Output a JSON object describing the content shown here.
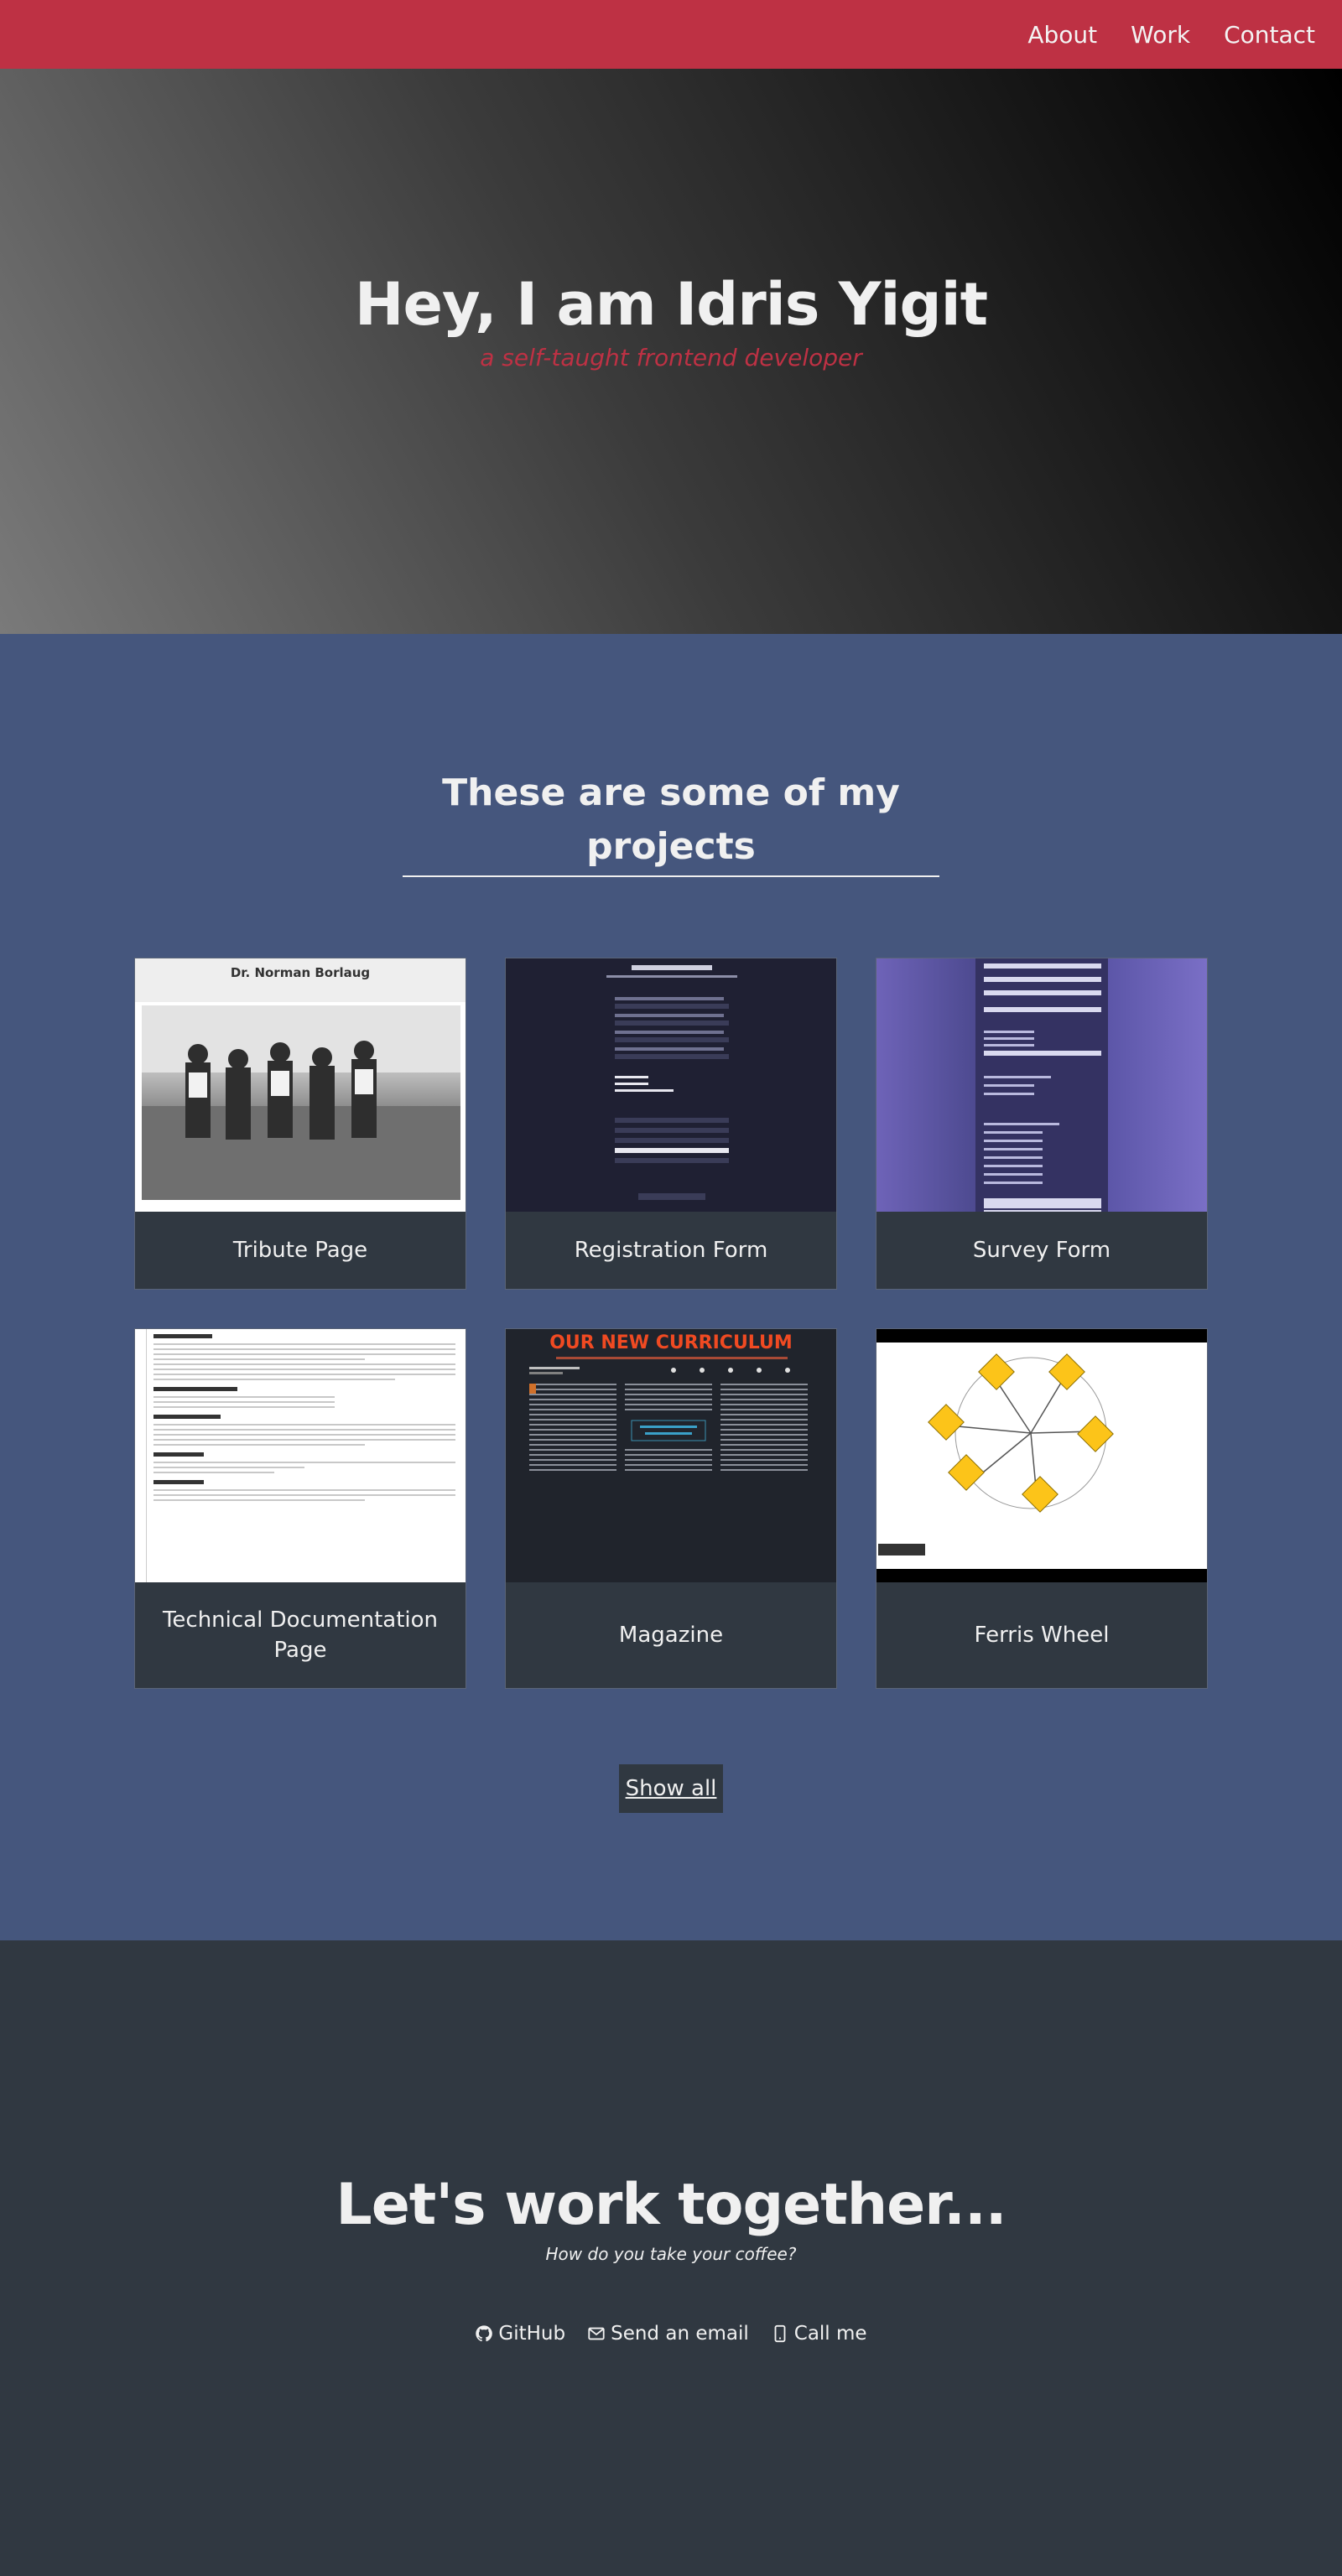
{
  "nav": {
    "links": [
      "About",
      "Work",
      "Contact"
    ]
  },
  "hero": {
    "title": "Hey, I am Idris Yigit",
    "subtitle": "a self-taught frontend developer"
  },
  "projects": {
    "heading": "These are some of my projects",
    "items": [
      {
        "caption": "Tribute Page"
      },
      {
        "caption": "Registration Form"
      },
      {
        "caption": "Survey Form"
      },
      {
        "caption": "Technical Documentation Page"
      },
      {
        "caption": "Magazine"
      },
      {
        "caption": "Ferris Wheel"
      }
    ],
    "show_all": "Show all"
  },
  "thumbs": {
    "tribute_title": "Dr. Norman Borlaug",
    "magazine_title": "OUR NEW CURRICULUM"
  },
  "contact": {
    "heading": "Let's work together...",
    "subheading": "How do you take your coffee?",
    "links": [
      {
        "label": "GitHub",
        "icon": "github-icon"
      },
      {
        "label": "Send an email",
        "icon": "envelope-icon"
      },
      {
        "label": "Call me",
        "icon": "mobile-phone-icon"
      }
    ]
  },
  "colors": {
    "nav": "#be3144",
    "accent": "#be3144",
    "projects_bg": "#45567d",
    "dark": "#303841"
  }
}
